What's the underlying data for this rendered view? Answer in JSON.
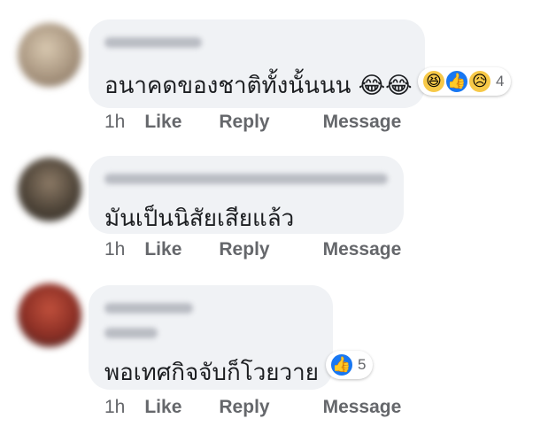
{
  "comments": [
    {
      "text": "อนาคดของชาติทั้งนั้นนน",
      "inline_emoji": "😂😂",
      "time": "1h",
      "like": "Like",
      "reply": "Reply",
      "message": "Message",
      "reactions": {
        "icons": [
          "😆",
          "👍",
          "😥"
        ],
        "count": "4"
      }
    },
    {
      "text": "มันเป็นนิสัยเสียแล้ว",
      "time": "1h",
      "like": "Like",
      "reply": "Reply",
      "message": "Message"
    },
    {
      "text": "พอเทศกิจจับก็โวยวาย",
      "time": "1h",
      "like": "Like",
      "reply": "Reply",
      "message": "Message",
      "reactions": {
        "icons": [
          "👍"
        ],
        "count": "5"
      }
    }
  ],
  "colors": {
    "bubble": "#f0f2f5",
    "text": "#1c1e21",
    "meta": "#65676b",
    "like_blue": "#1877f2"
  }
}
